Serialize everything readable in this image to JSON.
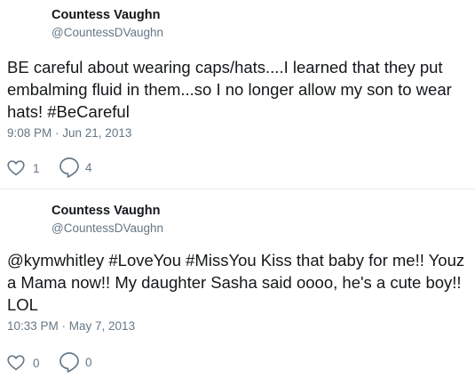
{
  "tweets": [
    {
      "author_name": "Countess Vaughn",
      "author_handle": "@CountessDVaughn",
      "text": "BE careful about wearing caps/hats....I learned that they put embalming fluid in them...so I no longer allow my son to wear hats! #BeCareful",
      "timestamp": "9:08 PM · Jun 21, 2013",
      "likes": "1",
      "replies": "4",
      "like_icon": "heart-outline-icon",
      "reply_icon": "speech-bubble-icon"
    },
    {
      "author_name": "Countess Vaughn",
      "author_handle": "@CountessDVaughn",
      "text": "@kymwhitley #LoveYou #MissYou Kiss that baby for me!! Youz a Mama now!! My daughter Sasha said oooo, he's a cute boy!! LOL",
      "timestamp": "10:33 PM · May 7, 2013",
      "likes": "0",
      "replies": "0",
      "like_icon": "heart-outline-icon",
      "reply_icon": "speech-bubble-icon"
    }
  ],
  "colors": {
    "text_primary": "#14171a",
    "text_secondary": "#657786",
    "divider": "#e6ecf0",
    "background": "#ffffff"
  }
}
